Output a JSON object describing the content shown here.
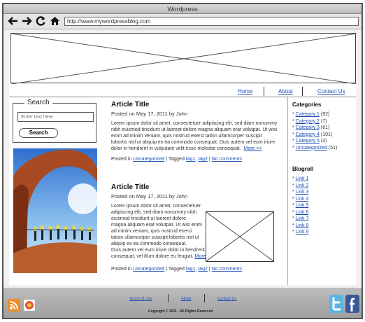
{
  "window": {
    "title": "Wordpress"
  },
  "browser": {
    "url": "http://www.mywordpressblog.com"
  },
  "nav": {
    "home": "Home",
    "about": "About",
    "contact": "Contact Us"
  },
  "search": {
    "title": "Search",
    "placeholder": "Enter text here",
    "button": "Search"
  },
  "articles": [
    {
      "title": "Article Title",
      "posted": "Posted on May 17, 2011 by John",
      "body": "Lorem ipsum dolor sit amet, consectetuer adipiscing elit, sed diam nonummy nibh euismod tincidunt ut laoreet dolore magna aliquam erat volutpat. Ut wisi enim ad minim veniam, quis nostrud exerci tation ullamcorper suscipit lobortis nisl ut aliquip ex ea commodo consequat. Duis autem vel eum iriure dolor in hendrerit in vulputate velit esse molestie consequat.",
      "more": "More >>",
      "posted_in": "Posted in",
      "category": "Uncategorized",
      "tagged": "| Tagged",
      "tag1": "tag1",
      "tag2": "tag2",
      "comments": "No comments"
    },
    {
      "title": "Article Title",
      "posted": "Posted on May 17, 2011 by John",
      "body_short": "Lorem ipsum dolor sit amet, consectetuer adipiscing elit, sed diam nonummy nibh euismod tincidunt ut laoreet dolore magna aliquam erat volutpat. Ut wisi enim ad minim veniam, quis nostrud exerci tation ullamcorper suscipit lobortis nisl ut aliquip ex ea commodo consequat.",
      "body_wide": "Duis autem vel eum iriure dolor in hendrerit in vulputate velit esse molestie consequat, vel illum dolore eu feugiat.",
      "more": "More >>",
      "posted_in": "Posted in",
      "category": "Uncategorized",
      "tagged": "| Tagged",
      "tag1": "tag1",
      "tag2": "tag2",
      "comments": "No comments"
    }
  ],
  "categories": {
    "title": "Categories",
    "items": [
      {
        "label": "Category 1",
        "count": "(92)"
      },
      {
        "label": "Category 2",
        "count": "(7)"
      },
      {
        "label": "Category 3",
        "count": "(61)"
      },
      {
        "label": "Category 4",
        "count": "(101)"
      },
      {
        "label": "Category 5",
        "count": "(3)"
      },
      {
        "label": "Uncategorized",
        "count": "(51)"
      }
    ]
  },
  "blogroll": {
    "title": "Blogroll",
    "items": [
      "Link 1",
      "Link 2",
      "Link 3",
      "Link 4",
      "Link 5",
      "Link 6",
      "Link 7",
      "Link 8",
      "Link 9"
    ]
  },
  "footer": {
    "terms": "Terms of Use",
    "about": "About",
    "contact": "Contact Us",
    "copyright": "Copyright © 2011 - All Rights Reserved"
  },
  "icons": {
    "back": "back-arrow-icon",
    "forward": "forward-arrow-icon",
    "refresh": "refresh-icon",
    "home": "home-icon",
    "rss": "rss-icon",
    "share": "share-icon",
    "twitter": "twitter-icon",
    "facebook": "facebook-icon"
  },
  "colors": {
    "link": "#1f4fb5",
    "rss": "#f08a24",
    "twitter": "#5fb3e0",
    "facebook": "#3b5998"
  }
}
